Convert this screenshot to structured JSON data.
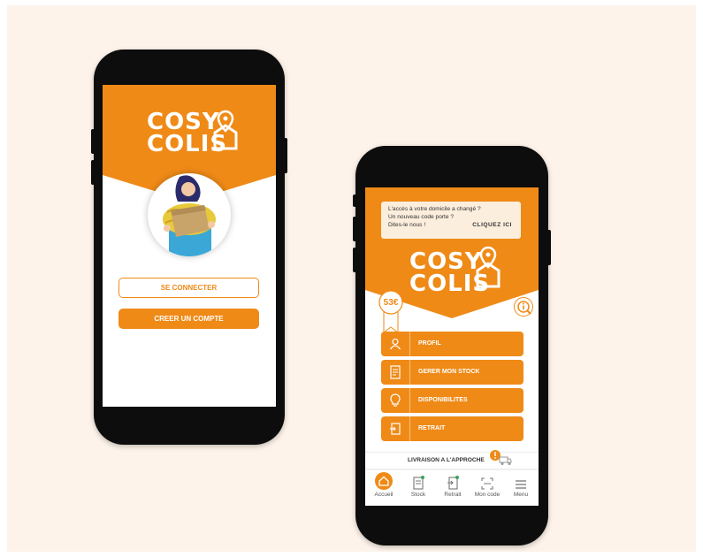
{
  "colors": {
    "accent": "#ef8a17",
    "background": "#fdf3ea",
    "phone": "#0d0d0d"
  },
  "login_screen": {
    "logo": {
      "line1": "COSY",
      "line2": "COLIS"
    },
    "connect_button": "SE CONNECTER",
    "create_account_button": "CREER UN COMPTE"
  },
  "home_screen": {
    "notice": {
      "line1": "L'accès à votre domicile a changé ?",
      "line2": "Un nouveau code porte ?",
      "line3": "Dites-le nous !",
      "cta": "CLIQUEZ ICI"
    },
    "logo": {
      "line1": "COSY",
      "line2": "COLIS"
    },
    "earnings_badge": "53€",
    "menu": [
      {
        "label": "PROFIL",
        "icon": "user-icon"
      },
      {
        "label": "GERER MON STOCK",
        "icon": "document-icon"
      },
      {
        "label": "DISPONIBILITES",
        "icon": "lightbulb-icon"
      },
      {
        "label": "RETRAIT",
        "icon": "withdraw-icon"
      }
    ],
    "delivery_banner": "LIVRAISON A L'APPROCHE",
    "tabs": [
      {
        "label": "Accueil",
        "icon": "home-icon"
      },
      {
        "label": "Stock",
        "icon": "stock-icon"
      },
      {
        "label": "Retrait",
        "icon": "retrait-icon"
      },
      {
        "label": "Mon code",
        "icon": "scan-icon"
      },
      {
        "label": "Menu",
        "icon": "menu-icon"
      }
    ]
  }
}
